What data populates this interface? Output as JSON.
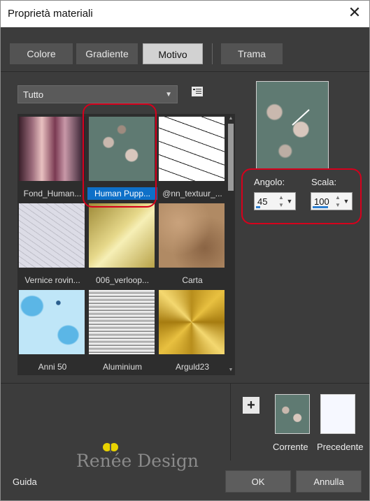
{
  "window": {
    "title": "Proprietà materiali"
  },
  "tabs": [
    {
      "label": "Colore",
      "active": false
    },
    {
      "label": "Gradiente",
      "active": false
    },
    {
      "label": "Motivo",
      "active": true
    },
    {
      "label": "Trama",
      "active": false
    }
  ],
  "category": {
    "selected": "Tutto"
  },
  "patterns": [
    {
      "name": "Fond_Human...",
      "selected": false
    },
    {
      "name": "Human Pupp...",
      "selected": true
    },
    {
      "name": "@nn_textuur_...",
      "selected": false
    },
    {
      "name": "Vernice rovin...",
      "selected": false
    },
    {
      "name": "006_verloop...",
      "selected": false
    },
    {
      "name": "Carta",
      "selected": false
    },
    {
      "name": "Anni 50",
      "selected": false
    },
    {
      "name": "Aluminium",
      "selected": false
    },
    {
      "name": "Arguld23",
      "selected": false
    }
  ],
  "settings": {
    "angle_label": "Angolo:",
    "angle_value": "45",
    "scale_label": "Scala:",
    "scale_value": "100"
  },
  "swatches": {
    "current_label": "Corrente",
    "previous_label": "Precedente"
  },
  "buttons": {
    "help": "Guida",
    "ok": "OK",
    "cancel": "Annulla"
  },
  "colors": {
    "selection": "#0e70c8",
    "highlight_ring": "#d6001c",
    "background": "#3c3c3c"
  },
  "watermark": "Renée Design"
}
